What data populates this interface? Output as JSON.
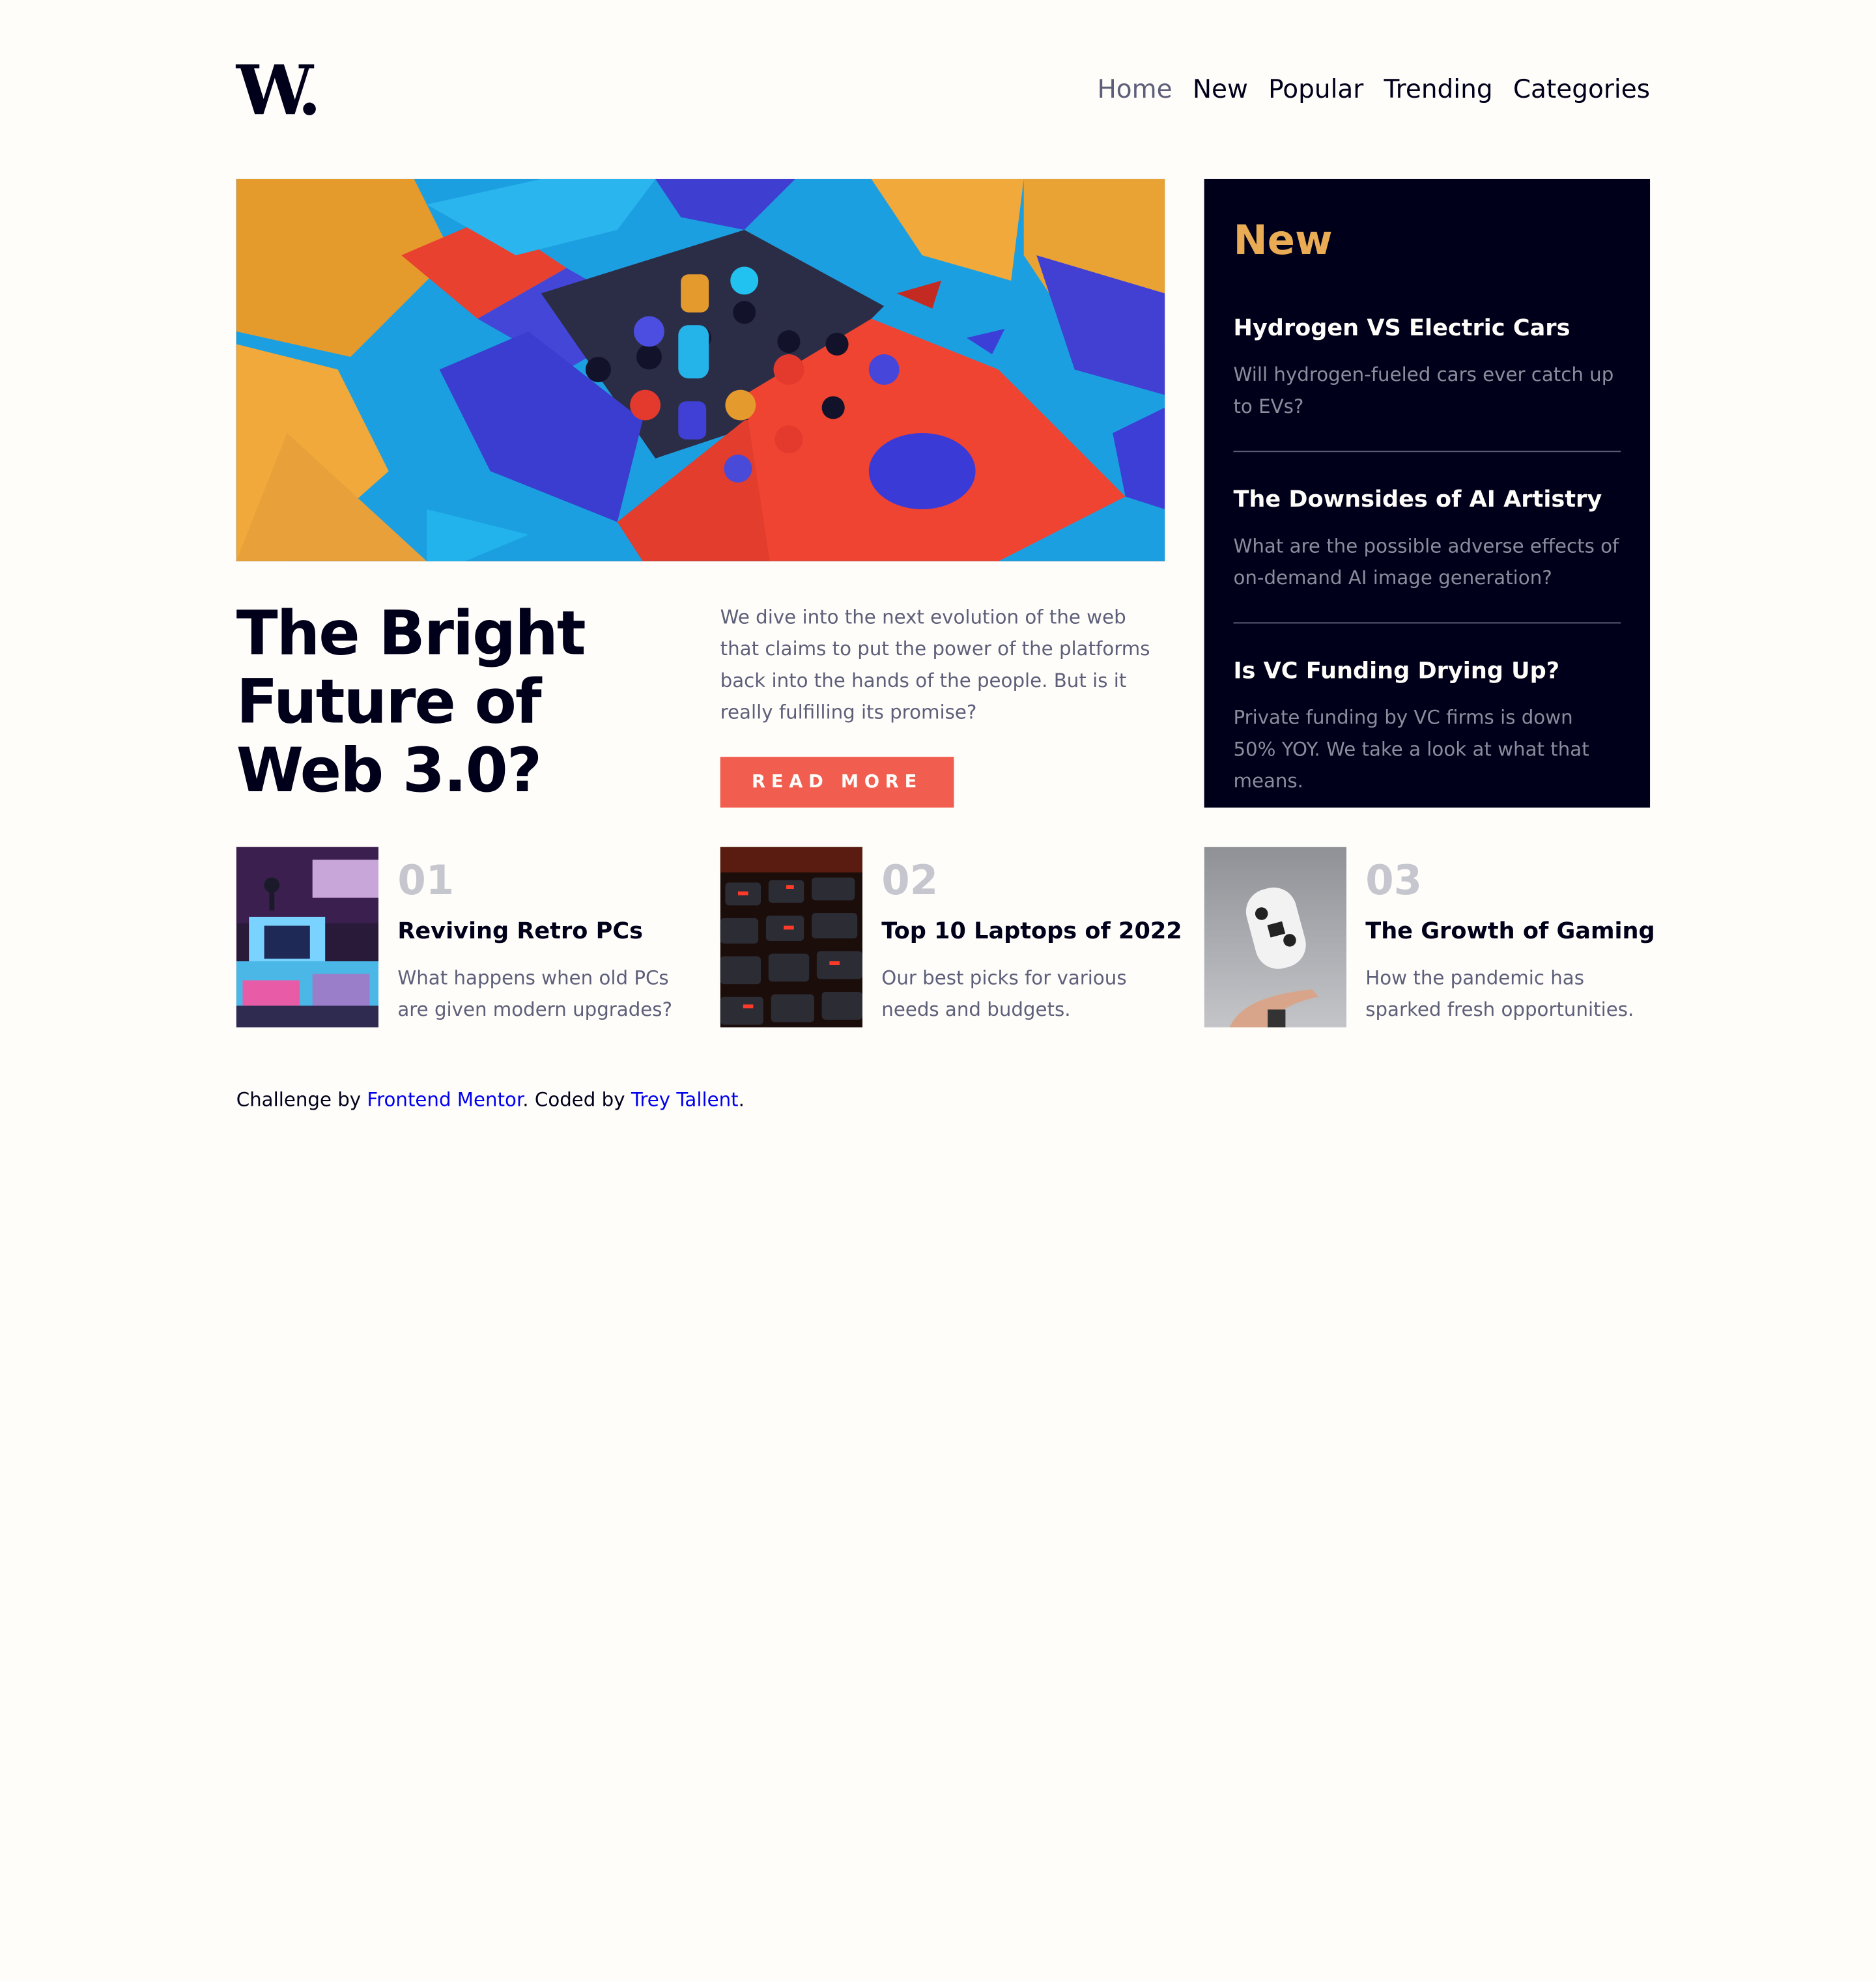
{
  "header": {
    "logo": "W.",
    "nav": [
      "Home",
      "New",
      "Popular",
      "Trending",
      "Categories"
    ]
  },
  "hero": {
    "title": "The Bright\nFuture of\nWeb 3.0?",
    "description": "We dive into the next evolution of the web that claims to put the power of the platforms back into the hands of the people. But is it really fulfilling its promise?",
    "button": "READ MORE"
  },
  "new_panel": {
    "title": "New",
    "items": [
      {
        "title": "Hydrogen VS Electric Cars",
        "description": "Will hydrogen-fueled cars ever catch up to EVs?"
      },
      {
        "title": "The Downsides of AI Artistry",
        "description": "What are the possible adverse effects of on-demand AI image generation?"
      },
      {
        "title": "Is VC Funding Drying Up?",
        "description": "Private funding by VC firms is down 50% YOY. We take a look at what that means."
      }
    ]
  },
  "top_list": [
    {
      "number": "01",
      "title": "Reviving Retro PCs",
      "description": "What happens when old PCs are given modern upgrades?"
    },
    {
      "number": "02",
      "title": "Top 10 Laptops of 2022",
      "description": "Our best picks for various needs and budgets."
    },
    {
      "number": "03",
      "title": "The Growth of Gaming",
      "description": "How the pandemic has sparked fresh opportunities."
    }
  ],
  "footer": {
    "prefix": "Challenge by ",
    "link1": "Frontend Mentor",
    "middle": ". Coded by ",
    "link2": "Trey Tallent",
    "suffix": "."
  },
  "colors": {
    "soft_orange": "#e9ab53",
    "soft_red": "#f15e50",
    "off_white": "#fffdfa",
    "grayish_blue": "#c5c6ce",
    "dark_grayish_blue": "#5d5f79",
    "very_dark_blue": "#00001a"
  }
}
